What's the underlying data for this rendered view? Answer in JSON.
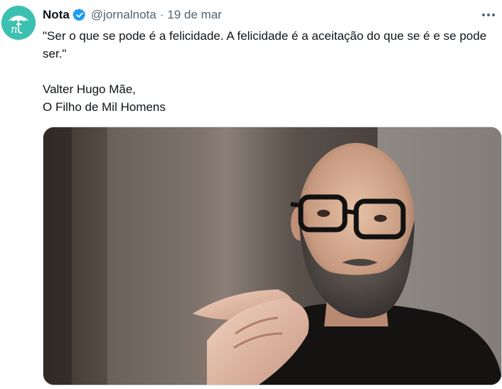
{
  "tweet": {
    "author_name": "Nota",
    "handle": "@jornalnota",
    "separator": "·",
    "date": "19 de mar",
    "avatar_icon": "umbrella-nt-logo",
    "verified_icon": "verified-badge-icon",
    "more_icon": "more-options-icon",
    "lines": [
      "\"Ser o que se pode é a felicidade. A felicidade é a aceitação do que se é e se pode ser.\"",
      "Valter Hugo Mãe,",
      "O Filho de Mil Homens"
    ],
    "media_alt": "photo"
  },
  "colors": {
    "avatar_bg": "#3cc1b0",
    "verified": "#1d9bf0",
    "secondary_text": "#536471",
    "primary_text": "#0f1419"
  }
}
